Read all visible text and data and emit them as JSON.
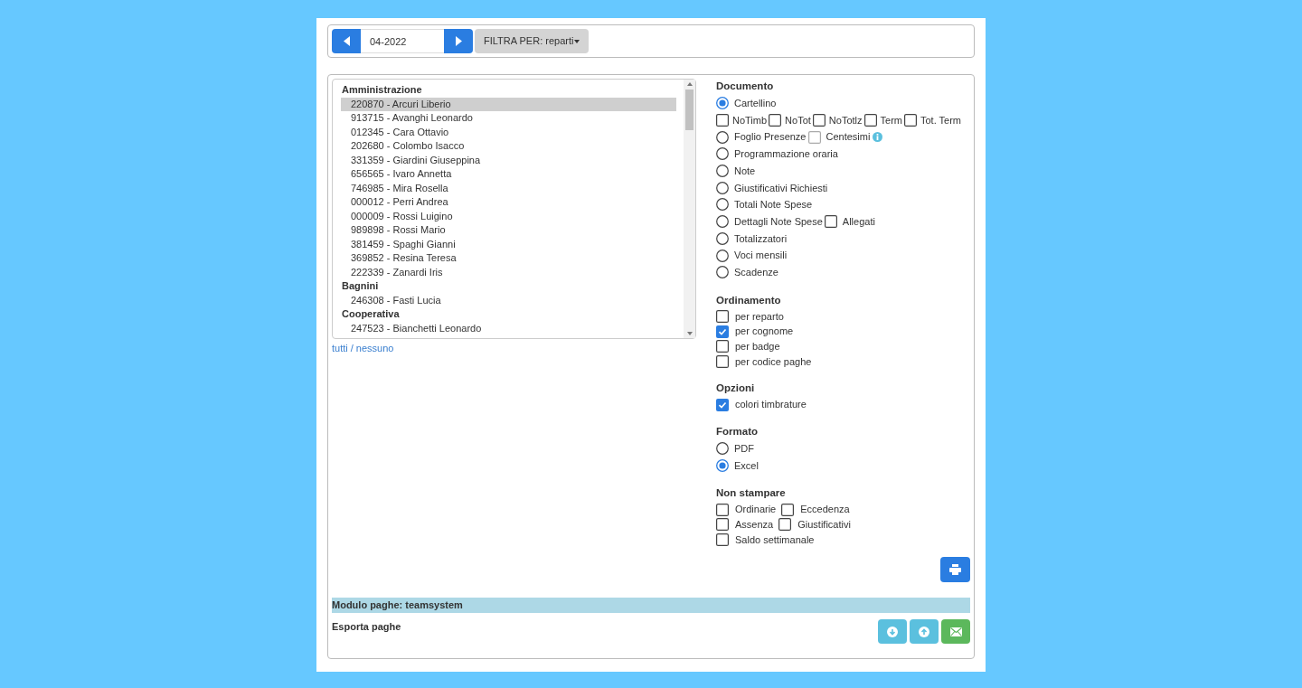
{
  "toolbar": {
    "period": "04-2022",
    "filter_button": "FILTRA PER: reparti"
  },
  "employee_list": {
    "groups": [
      {
        "label": "Amministrazione",
        "employees": [
          {
            "label": "220870 - Arcuri Liberio",
            "selected": true
          },
          {
            "label": "913715 - Avanghi Leonardo",
            "selected": false
          },
          {
            "label": "012345 - Cara Ottavio",
            "selected": false
          },
          {
            "label": "202680 - Colombo Isacco",
            "selected": false
          },
          {
            "label": "331359 - Giardini Giuseppina",
            "selected": false
          },
          {
            "label": "656565 - Ivaro Annetta",
            "selected": false
          },
          {
            "label": "746985 - Mira Rosella",
            "selected": false
          },
          {
            "label": "000012 - Perri Andrea",
            "selected": false
          },
          {
            "label": "000009 - Rossi Luigino",
            "selected": false
          },
          {
            "label": "989898 - Rossi Mario",
            "selected": false
          },
          {
            "label": "381459 - Spaghi Gianni",
            "selected": false
          },
          {
            "label": "369852 - Resina Teresa",
            "selected": false
          },
          {
            "label": "222339 - Zanardi Iris",
            "selected": false
          }
        ]
      },
      {
        "label": "Bagnini",
        "employees": [
          {
            "label": "246308 - Fasti Lucia",
            "selected": false
          }
        ]
      },
      {
        "label": "Cooperativa",
        "employees": [
          {
            "label": "247523 - Bianchetti Leonardo",
            "selected": false
          }
        ]
      }
    ],
    "link_all": "tutti",
    "link_separator": "/",
    "link_none": "nessuno"
  },
  "documento": {
    "title": "Documento",
    "rows": [
      {
        "kind": "radio",
        "label": "Cartellino",
        "selected": true
      },
      {
        "kind": "checkboxes",
        "items": [
          {
            "label": "NoTimb",
            "checked": false
          },
          {
            "label": "NoTot",
            "checked": false
          },
          {
            "label": "NoTotlz",
            "checked": false
          },
          {
            "label": "Term",
            "checked": false
          },
          {
            "label": "Tot. Term",
            "checked": false
          }
        ]
      },
      {
        "kind": "radio",
        "label": "Foglio Presenze",
        "selected": false,
        "extra": {
          "label": "Centesimi",
          "checked": false,
          "disabled": true,
          "info": true
        }
      },
      {
        "kind": "radio",
        "label": "Programmazione oraria",
        "selected": false
      },
      {
        "kind": "radio",
        "label": "Note",
        "selected": false
      },
      {
        "kind": "radio",
        "label": "Giustificativi Richiesti",
        "selected": false
      },
      {
        "kind": "radio",
        "label": "Totali Note Spese",
        "selected": false
      },
      {
        "kind": "radio",
        "label": "Dettagli Note Spese",
        "selected": false,
        "extra": {
          "label": "Allegati",
          "checked": false
        }
      },
      {
        "kind": "radio",
        "label": "Totalizzatori",
        "selected": false
      },
      {
        "kind": "radio",
        "label": "Voci mensili",
        "selected": false
      },
      {
        "kind": "radio",
        "label": "Scadenze",
        "selected": false
      }
    ]
  },
  "ordinamento": {
    "title": "Ordinamento",
    "items": [
      {
        "label": "per reparto",
        "checked": false
      },
      {
        "label": "per cognome",
        "checked": true
      },
      {
        "label": "per badge",
        "checked": false
      },
      {
        "label": "per codice paghe",
        "checked": false
      }
    ]
  },
  "opzioni": {
    "title": "Opzioni",
    "items": [
      {
        "label": "colori timbrature",
        "checked": true
      }
    ]
  },
  "formato": {
    "title": "Formato",
    "options": [
      {
        "label": "PDF",
        "selected": false
      },
      {
        "label": "Excel",
        "selected": true
      }
    ]
  },
  "non_stampare": {
    "title": "Non stampare",
    "rows": [
      [
        {
          "label": "Ordinarie",
          "checked": false
        },
        {
          "label": "Eccedenza",
          "checked": false
        }
      ],
      [
        {
          "label": "Assenza",
          "checked": false
        },
        {
          "label": "Giustificativi",
          "checked": false
        }
      ],
      [
        {
          "label": "Saldo settimanale",
          "checked": false
        }
      ]
    ]
  },
  "modulo_paghe": "Modulo paghe: teamsystem",
  "esporta_paghe": "Esporta paghe"
}
